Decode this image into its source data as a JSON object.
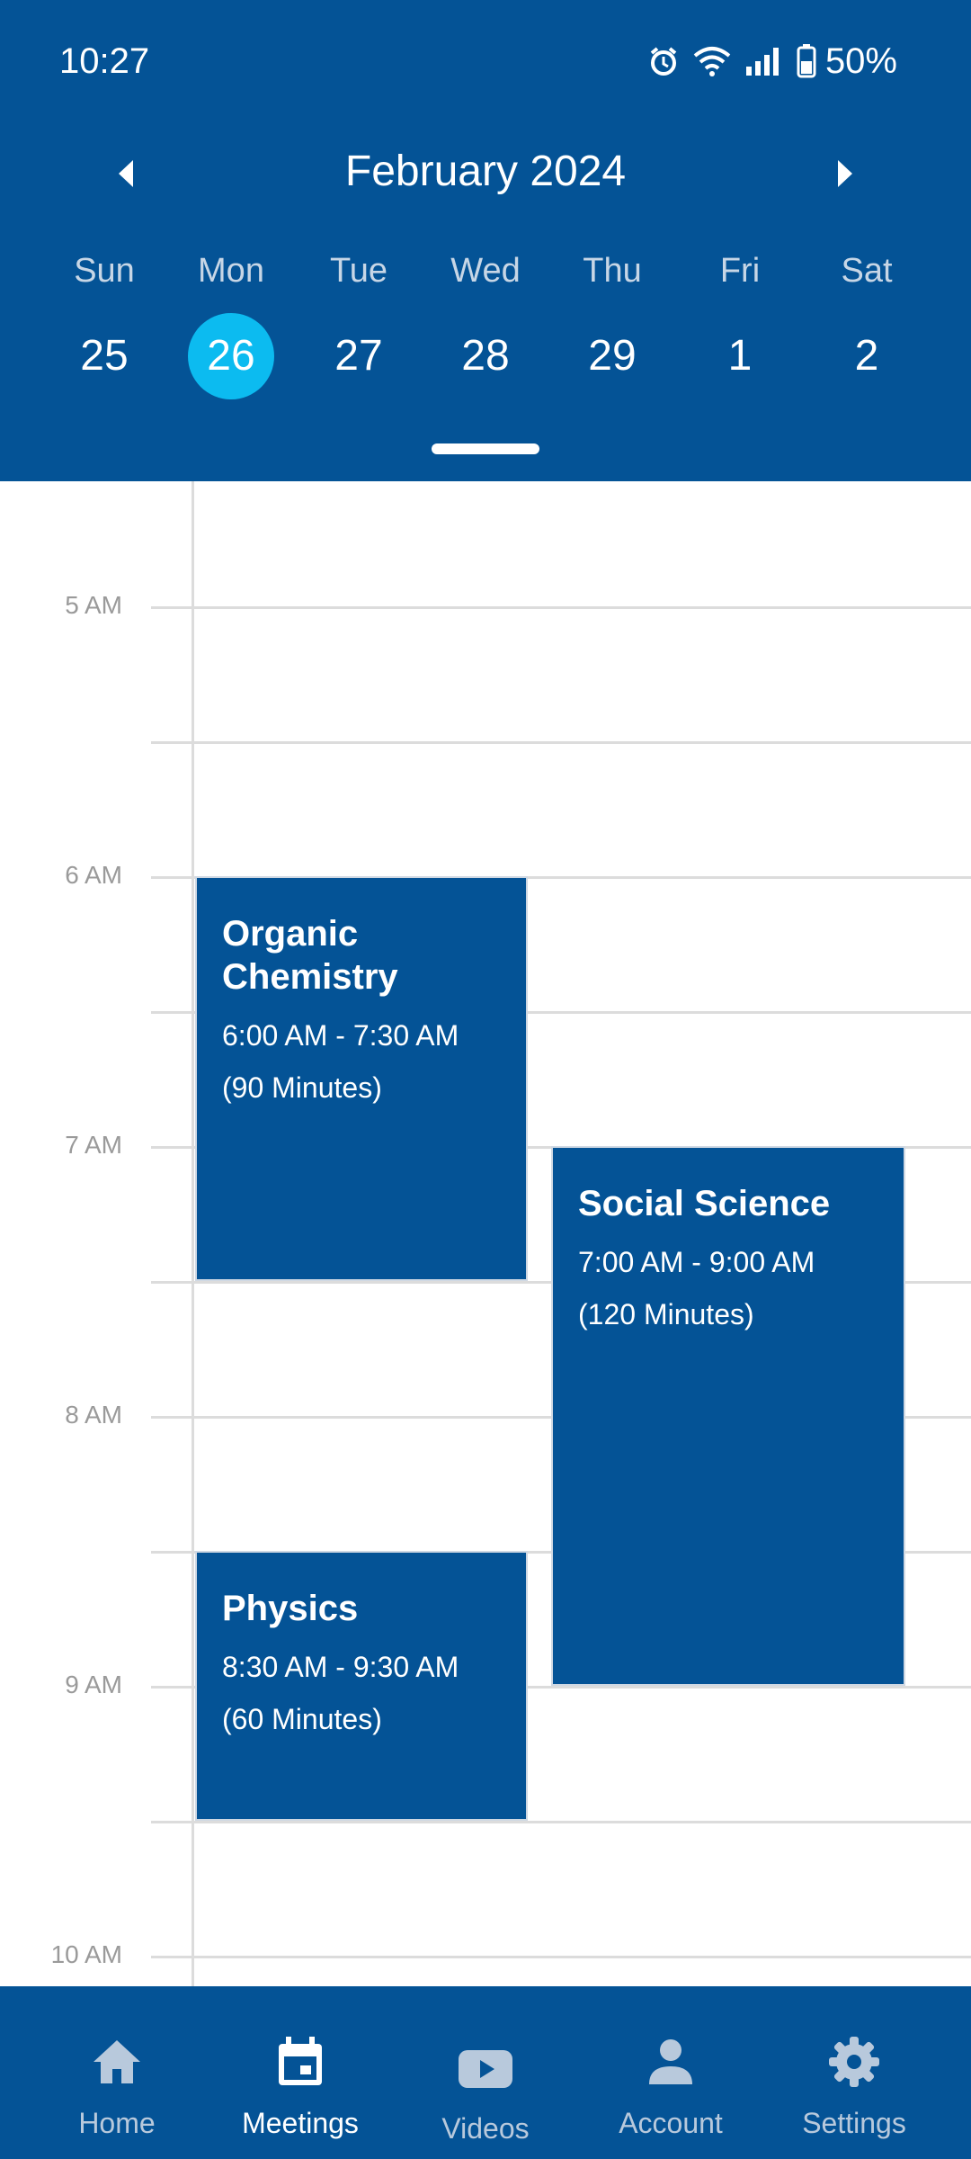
{
  "status_bar": {
    "time": "10:27",
    "battery": "50%",
    "icons": [
      "alarm-icon",
      "wifi-icon",
      "signal-icon",
      "battery-icon"
    ]
  },
  "calendar": {
    "month_title": "February 2024",
    "weekdays": [
      "Sun",
      "Mon",
      "Tue",
      "Wed",
      "Thu",
      "Fri",
      "Sat"
    ],
    "dates": [
      "25",
      "26",
      "27",
      "28",
      "29",
      "1",
      "2"
    ],
    "selected_date": "26"
  },
  "timeline": {
    "hour_labels": [
      "5 AM",
      "6 AM",
      "7 AM",
      "8 AM",
      "9 AM",
      "10 AM"
    ],
    "events": [
      {
        "title": "Organic Chemistry",
        "time": "6:00 AM - 7:30 AM",
        "duration": "(90 Minutes)"
      },
      {
        "title": "Social Science",
        "time": "7:00 AM - 9:00 AM",
        "duration": "(120 Minutes)"
      },
      {
        "title": "Physics",
        "time": "8:30 AM - 9:30 AM",
        "duration": "(60 Minutes)"
      }
    ]
  },
  "bottom_nav": {
    "items": [
      {
        "label": "Home",
        "icon": "home-icon"
      },
      {
        "label": "Meetings",
        "icon": "calendar-icon"
      },
      {
        "label": "Videos",
        "icon": "video-icon"
      },
      {
        "label": "Account",
        "icon": "account-icon"
      },
      {
        "label": "Settings",
        "icon": "settings-icon"
      }
    ],
    "active": "Meetings"
  },
  "colors": {
    "primary": "#045396",
    "selected_date": "#0cbbf0",
    "grid": "#dcdcdc"
  }
}
